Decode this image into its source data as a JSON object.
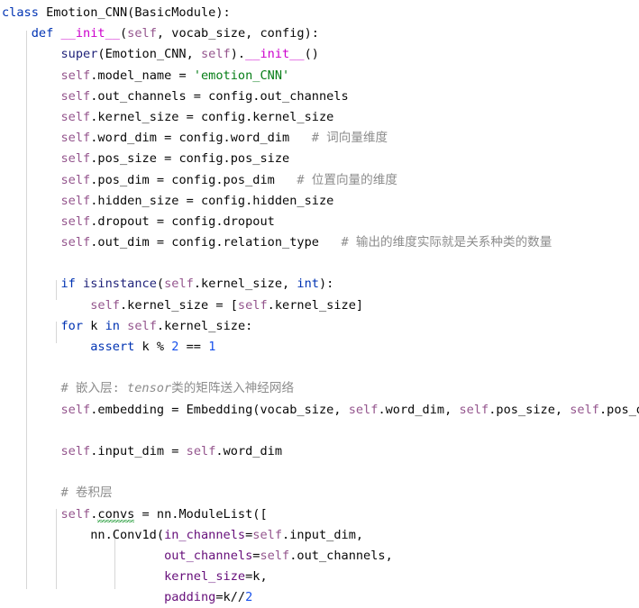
{
  "editor": {
    "language": "Python",
    "font_size_px": 13.6,
    "line_height_px": 23.2,
    "background": "#ffffff",
    "default_text_color": "#2b2b2b",
    "indent_guide_color": "#d6d6d6",
    "spellcheck_underline_color": "#2ea043"
  },
  "syntax_colors": {
    "keyword": "#0033b3",
    "builtin": "#20237a",
    "function_def": "#cc00cc",
    "self": "#94558d",
    "keyword_argument": "#660e7a",
    "string": "#067d17",
    "number": "#1750eb",
    "comment": "#8c8c8c",
    "plain": "#080808"
  },
  "code": {
    "lines": [
      "class Emotion_CNN(BasicModule):",
      "    def __init__(self, vocab_size, config):",
      "        super(Emotion_CNN, self).__init__()",
      "        self.model_name = 'emotion_CNN'",
      "        self.out_channels = config.out_channels",
      "        self.kernel_size = config.kernel_size",
      "        self.word_dim = config.word_dim   # 词向量维度",
      "        self.pos_size = config.pos_size",
      "        self.pos_dim = config.pos_dim   # 位置向量的维度",
      "        self.hidden_size = config.hidden_size",
      "        self.dropout = config.dropout",
      "        self.out_dim = config.relation_type   # 输出的维度实际就是关系种类的数量",
      "",
      "        if isinstance(self.kernel_size, int):",
      "            self.kernel_size = [self.kernel_size]",
      "        for k in self.kernel_size:",
      "            assert k % 2 == 1",
      "",
      "        # 嵌入层: tensor类的矩阵送入神经网络",
      "        self.embedding = Embedding(vocab_size, self.word_dim, self.pos_size, self.pos_dim)",
      "",
      "        self.input_dim = self.word_dim",
      "",
      "        # 卷积层",
      "        self.convs = nn.ModuleList([",
      "            nn.Conv1d(in_channels=self.input_dim,",
      "                      out_channels=self.out_channels,",
      "                      kernel_size=k,",
      "                      padding=k//2"
    ]
  },
  "comments": {
    "word_dim": "# 词向量维度",
    "pos_dim": "# 位置向量的维度",
    "out_dim": "# 输出的维度实际就是关系种类的数量",
    "embedding_layer": "# 嵌入层: tensor类的矩阵送入神经网络",
    "conv_layer": "# 卷积层"
  },
  "identifiers": {
    "class_name": "Emotion_CNN",
    "base_class": "BasicModule",
    "init_method": "__init__",
    "model_name_value": "'emotion_CNN'",
    "misspelled_token": "convs"
  }
}
